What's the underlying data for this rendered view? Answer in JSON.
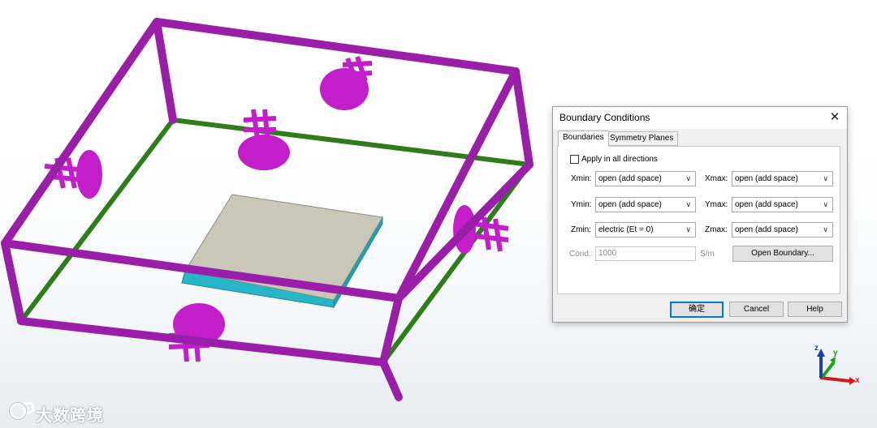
{
  "dialog": {
    "title": "Boundary Conditions",
    "close_glyph": "✕",
    "tabs": [
      {
        "label": "Boundaries",
        "active": true
      },
      {
        "label": "Symmetry Planes",
        "active": false
      }
    ],
    "apply_all": {
      "label": "Apply in all directions",
      "checked": false
    },
    "rows": [
      {
        "min_label": "Xmin:",
        "min_value": "open (add space)",
        "max_label": "Xmax:",
        "max_value": "open (add space)"
      },
      {
        "min_label": "Ymin:",
        "min_value": "open (add space)",
        "max_label": "Ymax:",
        "max_value": "open (add space)"
      },
      {
        "min_label": "Zmin:",
        "min_value": "electric (Et = 0)",
        "max_label": "Zmax:",
        "max_value": "open (add space)"
      }
    ],
    "cond": {
      "label": "Cond.:",
      "value": "1000",
      "unit": "S/m",
      "enabled": false
    },
    "open_boundary_button": "Open Boundary...",
    "ok_button": "确定",
    "cancel_button": "Cancel",
    "help_button": "Help"
  },
  "axes": {
    "x": "x",
    "y": "y",
    "z": "z"
  },
  "watermark": {
    "text": "大数跨境"
  },
  "colors": {
    "box_frame": "#9a1fa8",
    "ground_edge": "#2e7d1a",
    "patch_top": "#c9c7b8",
    "substrate_edge": "#27b6c6",
    "port": "#c21ec9",
    "axis_x": "#d01b1b",
    "axis_y": "#18a418",
    "axis_z": "#1b3fb0"
  }
}
